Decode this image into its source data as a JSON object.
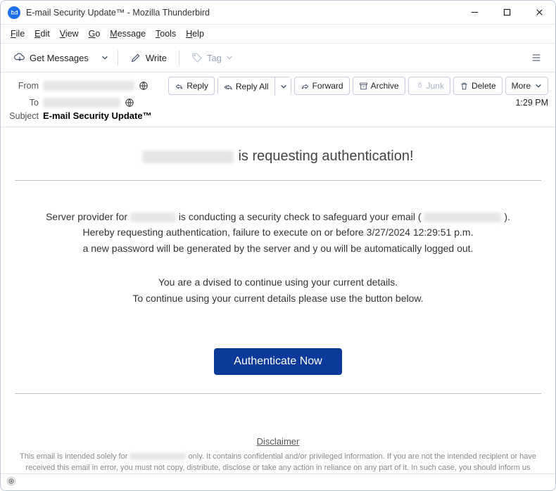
{
  "window": {
    "title": "E-mail Security Update™ - Mozilla Thunderbird"
  },
  "menubar": {
    "file": "File",
    "edit": "Edit",
    "view": "View",
    "go": "Go",
    "message": "Message",
    "tools": "Tools",
    "help": "Help"
  },
  "toolbar": {
    "get_messages": "Get Messages",
    "write": "Write",
    "tag": "Tag"
  },
  "header": {
    "from_label": "From",
    "to_label": "To",
    "subject_label": "Subject",
    "subject_value": "E-mail Security Update™",
    "timestamp": "1:29 PM",
    "actions": {
      "reply": "Reply",
      "reply_all": "Reply All",
      "forward": "Forward",
      "archive": "Archive",
      "junk": "Junk",
      "delete": "Delete",
      "more": "More"
    }
  },
  "body": {
    "heading_suffix": " is requesting authentication!",
    "p1_a": "Server provider for ",
    "p1_b": " is conducting a security check to safeguard your email ( ",
    "p1_c": " ).",
    "p2": "Hereby requesting authentication, failure to execute on or before 3/27/2024 12:29:51 p.m.",
    "p3": "a new password will be generated by the server and y ou will be automatically logged out.",
    "p4": "You are a dvised to continue using your current details.",
    "p5": "To continue using your current details please use the button below.",
    "cta": "Authenticate Now",
    "disclaimer_title": "Disclaimer",
    "disclaimer_a": "This email is intended solely for ",
    "disclaimer_b": " only. It contains confidential and/or privileged information. If you are not the intended recipient or have received this email in error, you must not copy, distribute, disclose or take any action in reliance on any part of it. In such case, you should inform us immediately and delete this email."
  }
}
